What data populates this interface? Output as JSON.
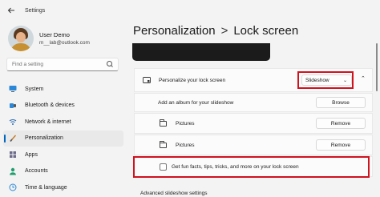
{
  "window": {
    "title": "Settings"
  },
  "user": {
    "name": "User Demo",
    "email": "m__lab@outlook.com"
  },
  "search": {
    "placeholder": "Find a setting"
  },
  "nav": {
    "items": [
      {
        "label": "System",
        "icon": "monitor-icon"
      },
      {
        "label": "Bluetooth & devices",
        "icon": "bluetooth-icon"
      },
      {
        "label": "Network & internet",
        "icon": "wifi-icon"
      },
      {
        "label": "Personalization",
        "icon": "brush-icon",
        "active": true
      },
      {
        "label": "Apps",
        "icon": "apps-icon"
      },
      {
        "label": "Accounts",
        "icon": "person-icon"
      },
      {
        "label": "Time & language",
        "icon": "globe-clock-icon"
      }
    ]
  },
  "breadcrumb": {
    "parent": "Personalization",
    "separator": ">",
    "current": "Lock screen"
  },
  "lock_screen": {
    "personalize_label": "Personalize your lock screen",
    "personalize_value": "Slideshow",
    "add_album_label": "Add an album for your slideshow",
    "browse_label": "Browse",
    "albums": [
      {
        "name": "Pictures",
        "action": "Remove"
      },
      {
        "name": "Pictures",
        "action": "Remove"
      }
    ],
    "fun_facts_label": "Get fun facts, tips, tricks, and more on your lock screen",
    "fun_facts_checked": false,
    "advanced_label": "Advanced slideshow settings"
  },
  "colors": {
    "accent": "#0067c0",
    "highlight": "#d0121e"
  }
}
